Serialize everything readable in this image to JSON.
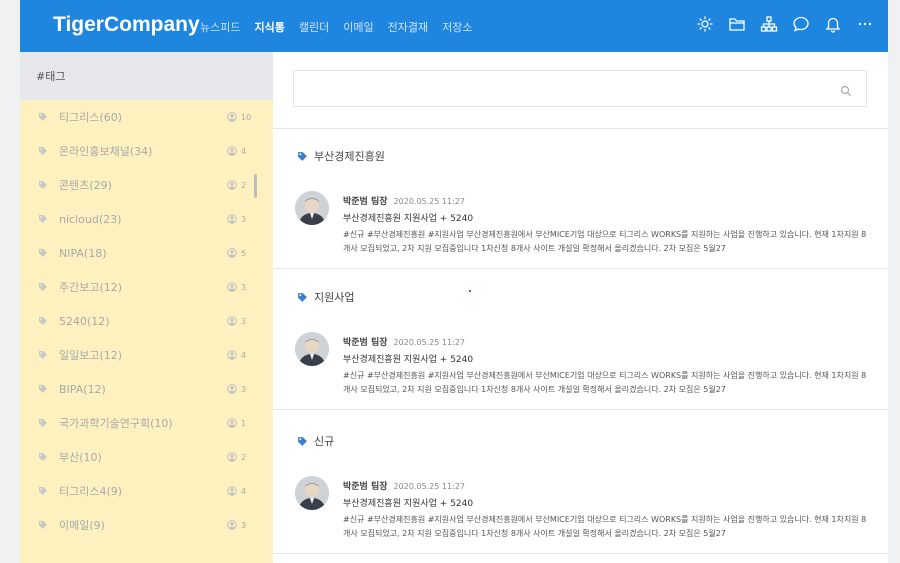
{
  "app": {
    "brand": "TigerCompany"
  },
  "nav": {
    "items": [
      "뉴스피드",
      "지식통",
      "캘린더",
      "이메일",
      "전자결재",
      "저장소"
    ],
    "active_index": 1
  },
  "header_icons": [
    "settings-icon",
    "folder-icon",
    "org-chart-icon",
    "chat-icon",
    "bell-icon",
    "more-icon"
  ],
  "sidebar": {
    "title": "#태그",
    "tags": [
      {
        "label": "티그리스(60)",
        "count": "10"
      },
      {
        "label": "온라인홍보채널(34)",
        "count": "4"
      },
      {
        "label": "콘텐츠(29)",
        "count": "2"
      },
      {
        "label": "nicloud(23)",
        "count": "3"
      },
      {
        "label": "NIPA(18)",
        "count": "5"
      },
      {
        "label": "주간보고(12)",
        "count": "3"
      },
      {
        "label": "5240(12)",
        "count": "3"
      },
      {
        "label": "일일보고(12)",
        "count": "4"
      },
      {
        "label": "BIPA(12)",
        "count": "3"
      },
      {
        "label": "국가과학기술연구회(10)",
        "count": "1"
      },
      {
        "label": "부산(10)",
        "count": "2"
      },
      {
        "label": "티그리스4(9)",
        "count": "4"
      },
      {
        "label": "이메일(9)",
        "count": "3"
      }
    ]
  },
  "search": {
    "placeholder": ""
  },
  "colors": {
    "topbar": "#1f86e0",
    "tag_icon": "#3a7bd5",
    "highlight": "#fdf1bf"
  },
  "sections": [
    {
      "title": "부산경제진흥원",
      "post": {
        "author": "박준범 팀장",
        "date": "2020.05.25 11:27",
        "title": "부산경제진흥원 지원사업 + 5240",
        "body": "#신규 #부산경제진흥원 #지원사업 부산경제진흥원에서 부산MICE기업 대상으로 티그리스 WORKS를 지원하는 사업을 진행하고 있습니다. 현재 1차지원 8개사 모집되었고, 2차 지원 모집중입니다 1차신청 8개사 사이트 개설일 확정해서 올리겠습니다. 2차 모집은 5월27"
      }
    },
    {
      "title": "지원사업",
      "post": {
        "author": "박준범 팀장",
        "date": "2020.05.25 11:27",
        "title": "부산경제진흥원 지원사업 + 5240",
        "body": "#신규 #부산경제진흥원 #지원사업 부산경제진흥원에서 부산MICE기업 대상으로 티그리스 WORKS를 지원하는 사업을 진행하고 있습니다. 현재 1차지원 8개사 모집되었고, 2차 지원 모집중입니다 1차신청 8개사 사이트 개설일 확정해서 올리겠습니다. 2차 모집은 5월27"
      }
    },
    {
      "title": "신규",
      "post": {
        "author": "박준범 팀장",
        "date": "2020.05.25 11:27",
        "title": "부산경제진흥원 지원사업 + 5240",
        "body": "#신규 #부산경제진흥원 #지원사업 부산경제진흥원에서 부산MICE기업 대상으로 티그리스 WORKS를 지원하는 사업을 진행하고 있습니다. 현재 1차지원 8개사 모집되었고, 2차 지원 모집중입니다 1차신청 8개사 사이트 개설일 확정해서 올리겠습니다. 2차 모집은 5월27"
      }
    }
  ]
}
